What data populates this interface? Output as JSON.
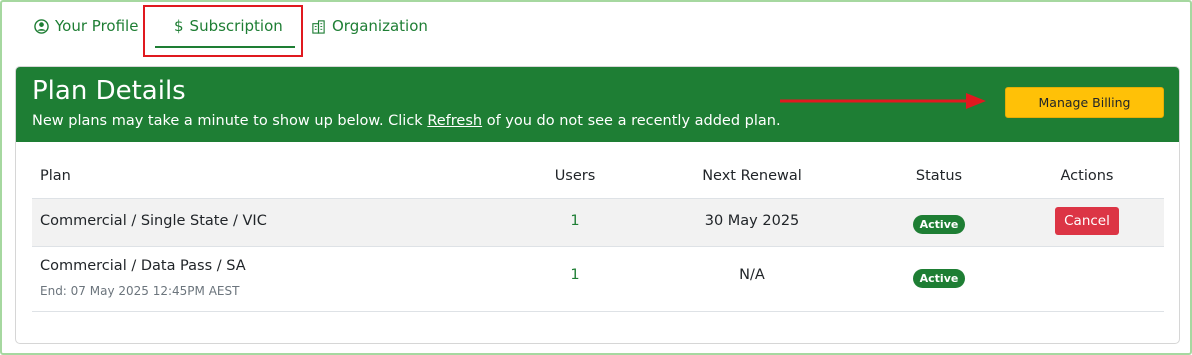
{
  "tabs": [
    {
      "label": "Your Profile",
      "icon": "user-circle-icon"
    },
    {
      "label": "Subscription",
      "icon": "dollar-icon",
      "active": true
    },
    {
      "label": "Organization",
      "icon": "building-icon"
    }
  ],
  "card": {
    "title": "Plan Details",
    "subtitle_before": "New plans may take a minute to show up below. Click ",
    "subtitle_link": "Refresh",
    "subtitle_after": " of you do not see a recently added plan.",
    "manage_billing_label": "Manage Billing"
  },
  "table": {
    "headers": {
      "plan": "Plan",
      "users": "Users",
      "renewal": "Next Renewal",
      "status": "Status",
      "actions": "Actions"
    },
    "rows": [
      {
        "plan": "Commercial / Single State / VIC",
        "end": "",
        "users": "1",
        "renewal": "30 May 2025",
        "status": "Active",
        "action": "Cancel"
      },
      {
        "plan": "Commercial / Data Pass / SA",
        "end": "End: 07 May 2025 12:45PM AEST",
        "users": "1",
        "renewal": "N/A",
        "status": "Active",
        "action": ""
      }
    ]
  },
  "colors": {
    "brand_green": "#1e7e34",
    "warning_yellow": "#ffc107",
    "danger_red": "#dc3545",
    "annotation_red": "#e0191f"
  }
}
